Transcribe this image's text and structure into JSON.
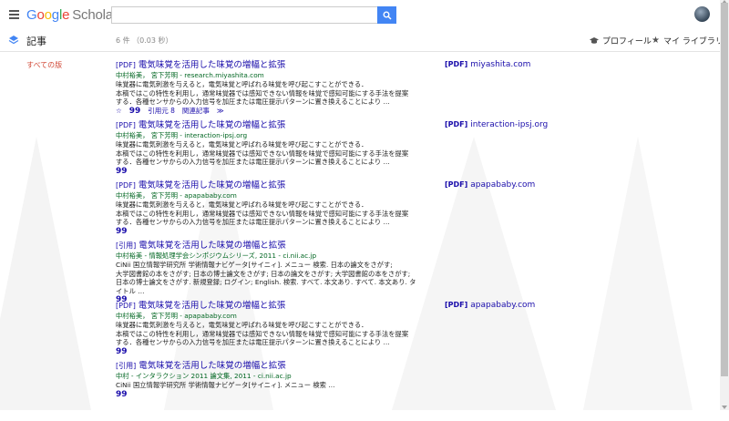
{
  "app": {
    "logo_google": "Google",
    "logo_scholar": "Scholar"
  },
  "search": {
    "value": "",
    "placeholder": ""
  },
  "subbar": {
    "section_title": "記事",
    "stats": "6 件 （0.03 秒）",
    "profile_label": "プロフィール",
    "library_label": "マイ ライブラリ"
  },
  "sidebar": {
    "all_versions": "すべての版"
  },
  "results": [
    {
      "tag": "[PDF]",
      "title": "電気味覚を活用した味覚の増幅と拡張",
      "authors": "中村裕美， 宮下芳明 - research.miyashita.com",
      "snippet": "味覚器に電気刺激を与えると，電気味覚と呼ばれる味覚を呼び起こすことができる．\n本稿ではこの特性を利用し，通常味覚器では感知できない情報を味覚で感知可能にする手法を提案\nする．各種センサからの入力信号を加圧または電圧提示パターンに置き換えることにより …",
      "actions": [
        "☆",
        "99",
        "引用元 8",
        "関連記事",
        "≫"
      ],
      "side_tag": "[PDF]",
      "side_link": "miyashita.com"
    },
    {
      "tag": "[PDF]",
      "title": "電気味覚を活用した味覚の増幅と拡張",
      "authors": "中村裕美， 宮下芳明 - interaction-ipsj.org",
      "snippet": "味覚器に電気刺激を与えると，電気味覚と呼ばれる味覚を呼び起こすことができる．\n本稿ではこの特性を利用し，通常味覚器では感知できない情報を味覚で感知可能にする手法を提案\nする．各種センサからの入力信号を加圧または電圧提示パターンに置き換えることにより …",
      "actions": [
        "99"
      ],
      "side_tag": "[PDF]",
      "side_link": "interaction-ipsj.org"
    },
    {
      "tag": "[PDF]",
      "title": "電気味覚を活用した味覚の増幅と拡張",
      "authors": "中村裕美， 宮下芳明 - apapababy.com",
      "snippet": "味覚器に電気刺激を与えると，電気味覚と呼ばれる味覚を呼び起こすことができる．\n本稿ではこの特性を利用し，通常味覚器では感知できない情報を味覚で感知可能にする手法を提案\nする．各種センサからの入力信号を加圧または電圧提示パターンに置き換えることにより …",
      "actions": [
        "99"
      ],
      "side_tag": "[PDF]",
      "side_link": "apapababy.com"
    },
    {
      "tag": "[引用]",
      "title": "電気味覚を活用した味覚の増幅と拡張",
      "authors": "中村裕美 - 情報処理学会シンポジウムシリーズ, 2011 - ci.nii.ac.jp",
      "snippet": "CiNii 国立情報学研究所 学術情報ナビゲータ[サイニィ]. メニュー 検索. 日本の論文をさがす;\n大学図書館の本をさがす; 日本の博士論文をさがす; 日本の論文をさがす; 大学図書館の本をさがす;\n日本の博士論文をさがす. 新規登録; ログイン; English. 検索. すべて. 本文あり. すべて. 本文あり. タイトル …",
      "actions": [
        "99"
      ],
      "side_tag": "",
      "side_link": ""
    },
    {
      "tag": "[PDF]",
      "title": "電気味覚を活用した味覚の増幅と拡張",
      "authors": "中村裕美， 宮下芳明 - apapababy.com",
      "snippet": "味覚器に電気刺激を与えると，電気味覚と呼ばれる味覚を呼び起こすことができる．\n本稿ではこの特性を利用し，通常味覚器では感知できない情報を味覚で感知可能にする手法を提案\nする．各種センサからの入力信号を加圧または電圧提示パターンに置き換えることにより …",
      "actions": [
        "99"
      ],
      "side_tag": "[PDF]",
      "side_link": "apapababy.com"
    },
    {
      "tag": "[引用]",
      "title": "電気味覚を活用した味覚の増幅と拡張",
      "authors": "中村 - インタラクション 2011 論文集, 2011 - ci.nii.ac.jp",
      "snippet": "CiNii 国立情報学研究所 学術情報ナビゲータ[サイニィ]. メニュー 検索 …",
      "actions": [
        "99"
      ],
      "side_tag": "",
      "side_link": ""
    }
  ]
}
